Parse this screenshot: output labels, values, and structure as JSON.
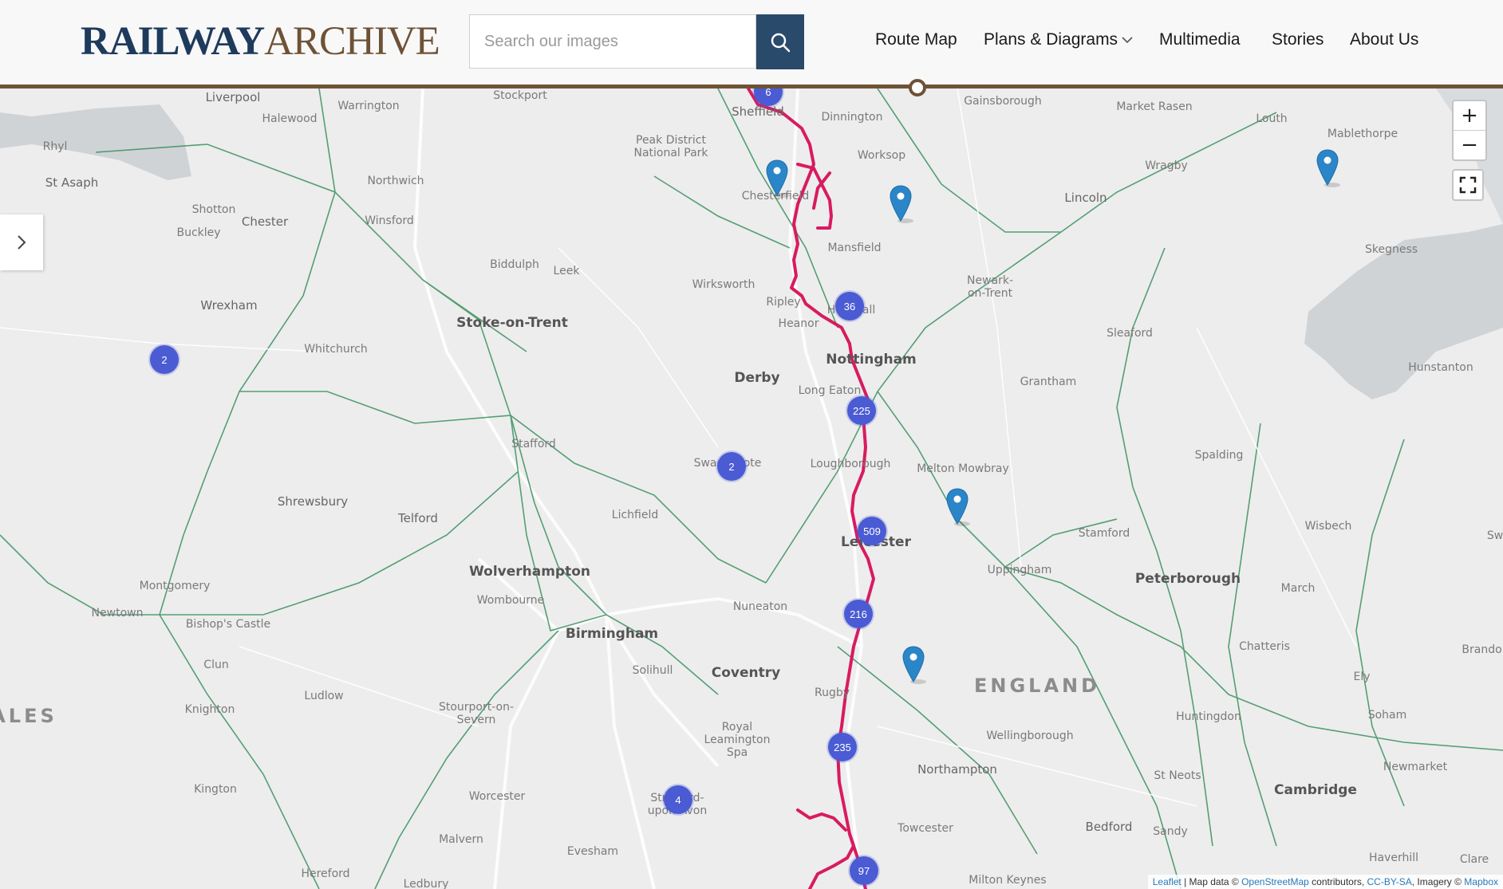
{
  "header": {
    "logo_part1": "RAILWAY",
    "logo_part2": "ARCHIVE",
    "search_placeholder": "Search our images",
    "nav": [
      "Route Map",
      "Plans & Diagrams",
      "Multimedia",
      "Stories",
      "About Us"
    ]
  },
  "map": {
    "region_labels": [
      "ENGLAND",
      "ALES"
    ],
    "cities": [
      "Liverpool",
      "Warrington",
      "Stockport",
      "Sheffield",
      "Dinnington",
      "Gainsborough",
      "Market Rasen",
      "Louth",
      "Mablethorpe",
      "Halewood",
      "Rhyl",
      "St Asaph",
      "Peak District National Park",
      "Worksop",
      "Wragby",
      "Northwich",
      "Chesterfield",
      "Lincoln",
      "Shotton",
      "Chester",
      "Buckley",
      "Winsford",
      "Skegness",
      "Biddulph",
      "Leek",
      "Mansfield",
      "Newark-on-Trent",
      "Wirksworth",
      "Wrexham",
      "Ripley",
      "Hucknall",
      "Stoke-on-Trent",
      "Heanor",
      "Sleaford",
      "Whitchurch",
      "Nottingham",
      "Derby",
      "Long Eaton",
      "Grantham",
      "Hunstanton",
      "Stafford",
      "Swadlincote",
      "Loughborough",
      "Melton Mowbray",
      "Spalding",
      "Shrewsbury",
      "Telford",
      "Lichfield",
      "Leicester",
      "Stamford",
      "Wisbech",
      "Wolverhampton",
      "Uppingham",
      "Peterborough",
      "Montgomery",
      "Wombourne",
      "Nuneaton",
      "March",
      "Newtown",
      "Bishop's Castle",
      "Birmingham",
      "Chatteris",
      "Clun",
      "Solihull",
      "Coventry",
      "Ely",
      "Ludlow",
      "Rugby",
      "Knighton",
      "Stourport-on-Severn",
      "Royal Leamington Spa",
      "Huntingdon",
      "Soham",
      "Wellingborough",
      "Kington",
      "Northampton",
      "St Neots",
      "Newmarket",
      "Worcester",
      "Stratford-upon-Avon",
      "Cambridge",
      "Towcester",
      "Malvern",
      "Bedford",
      "Sandy",
      "Evesham",
      "Haverhill",
      "Clare",
      "Hereford",
      "Ledbury",
      "Milton Keynes",
      "Brandon",
      "Sw"
    ],
    "clusters": [
      "6",
      "36",
      "225",
      "2",
      "509",
      "216",
      "2",
      "235",
      "4",
      "97"
    ],
    "zoom_in": "+",
    "zoom_out": "−",
    "attribution": {
      "leaflet": "Leaflet",
      "text1": " | Map data © ",
      "osm": "OpenStreetMap",
      "text2": " contributors, ",
      "license": "CC-BY-SA",
      "text3": ", Imagery © ",
      "mapbox": "Mapbox"
    },
    "colors": {
      "route": "#d81b60",
      "cluster": "#4a5bd4",
      "pin": "#2a86c8",
      "rail": "#2e8b57",
      "header_rule": "#6e5236"
    }
  }
}
